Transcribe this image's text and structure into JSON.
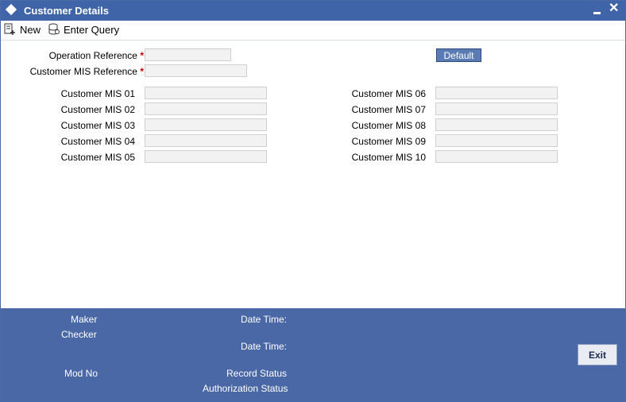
{
  "window": {
    "title": "Customer Details"
  },
  "toolbar": {
    "new_label": "New",
    "enter_query_label": "Enter Query"
  },
  "form": {
    "operation_reference_label": "Operation Reference",
    "customer_mis_reference_label": "Customer MIS Reference",
    "required_marker": "*",
    "default_button_label": "Default",
    "mis_left": [
      "Customer MIS 01",
      "Customer MIS 02",
      "Customer MIS 03",
      "Customer MIS 04",
      "Customer MIS 05"
    ],
    "mis_right": [
      "Customer MIS 06",
      "Customer MIS 07",
      "Customer MIS 08",
      "Customer MIS 09",
      "Customer MIS 10"
    ]
  },
  "footer": {
    "maker": "Maker",
    "checker": "Checker",
    "date_time_1": "Date Time:",
    "date_time_2": "Date Time:",
    "mod_no": "Mod No",
    "record_status": "Record Status",
    "authorization_status": "Authorization Status",
    "exit_label": "Exit"
  },
  "colors": {
    "title_bar": "#3f64a8",
    "footer": "#4a67a6",
    "required": "#c00000"
  }
}
